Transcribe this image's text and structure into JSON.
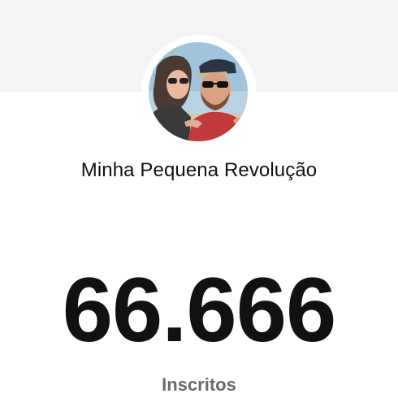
{
  "channel": {
    "name": "Minha Pequena Revolução",
    "avatar_icon": "channel-avatar-photo"
  },
  "stats": {
    "subscriber_count": "66.666",
    "subscriber_label": "Inscritos"
  },
  "colors": {
    "background": "#ffffff",
    "top_band": "#f4f4f4",
    "count_text": "#111111",
    "label_text": "#6a6a6a"
  }
}
